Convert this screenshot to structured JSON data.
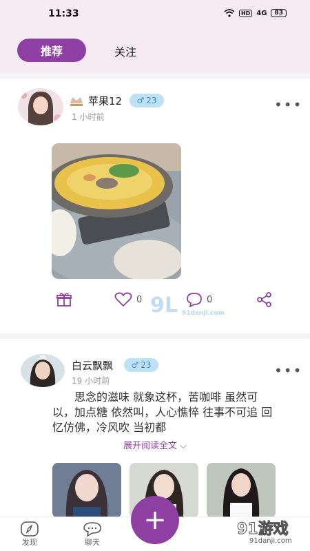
{
  "statusbar": {
    "time": "11:33",
    "hd": "HD",
    "signal": "4G",
    "battery": "83"
  },
  "tabs": {
    "recommend": "推荐",
    "follow": "关注"
  },
  "posts": [
    {
      "username": "苹果12",
      "gender_symbol": "♂",
      "age": "23",
      "time": "1 小时前",
      "like_count": "0",
      "comment_count": "0"
    },
    {
      "username": "白云飘飘",
      "gender_symbol": "♂",
      "age": "23",
      "time": "19 小时前",
      "text": "思念的滋味 就象这杯，苦咖啡 虽然可以，加点糖 依然叫，人心憔悴 往事不可追 回忆仿佛，冷风吹 当初都",
      "expand_label": "展开阅读全文"
    }
  ],
  "nav": {
    "discover": "发现",
    "chat": "聊天"
  },
  "watermark": {
    "logo_text": "91游戏",
    "url_text": "91danji.com",
    "center_logo": "9L",
    "center_url": "91danji.com"
  },
  "colors": {
    "accent": "#8e3fa2",
    "tab_bg": "#f6eaf3",
    "badge_bg": "#bfe1f5",
    "badge_fg": "#3b8fd0"
  }
}
